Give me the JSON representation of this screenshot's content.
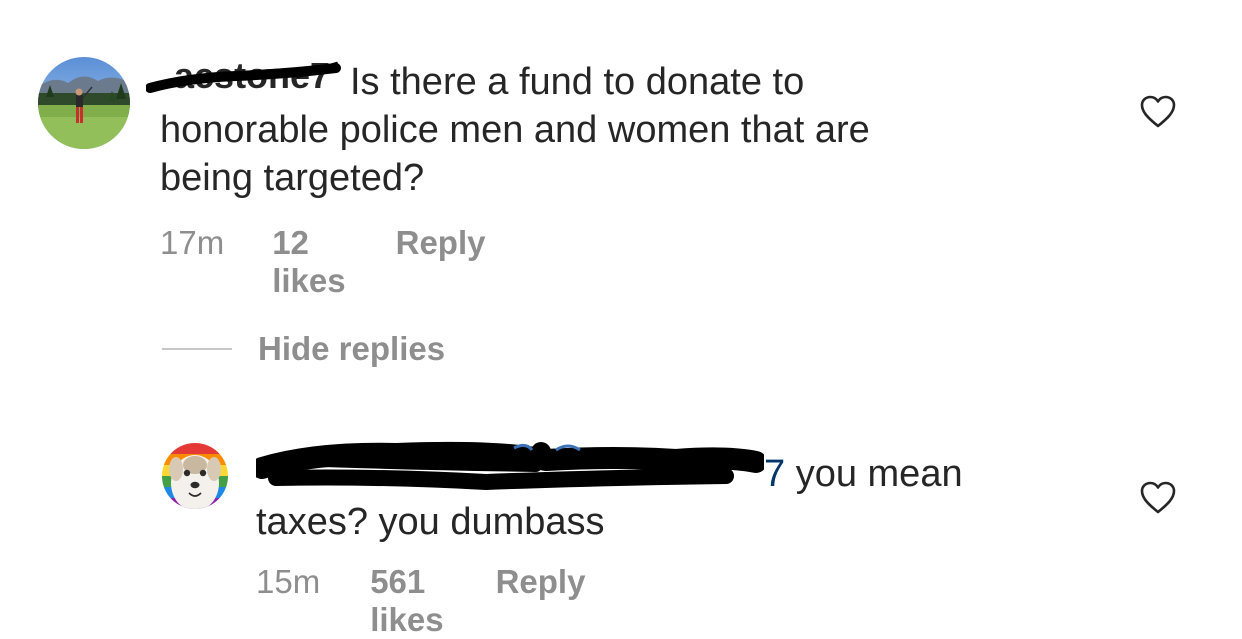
{
  "comments": [
    {
      "username": "acstone7",
      "text_line1": "Is there a fund to donate to",
      "text_line2": "honorable police men and women that are",
      "text_line3": "being targeted?",
      "time": "17m",
      "likes": "12 likes",
      "reply": "Reply"
    },
    {
      "username_visible_end": "7",
      "text_line1": "you mean",
      "text_line2": "taxes? you dumbass",
      "time": "15m",
      "likes": "561 likes",
      "reply": "Reply"
    }
  ],
  "replies": {
    "toggle_label": "Hide replies"
  },
  "icons": {
    "like": "heart-outline-icon"
  },
  "colors": {
    "text": "#262626",
    "secondary": "#8e8e8e",
    "mention": "#003569"
  }
}
